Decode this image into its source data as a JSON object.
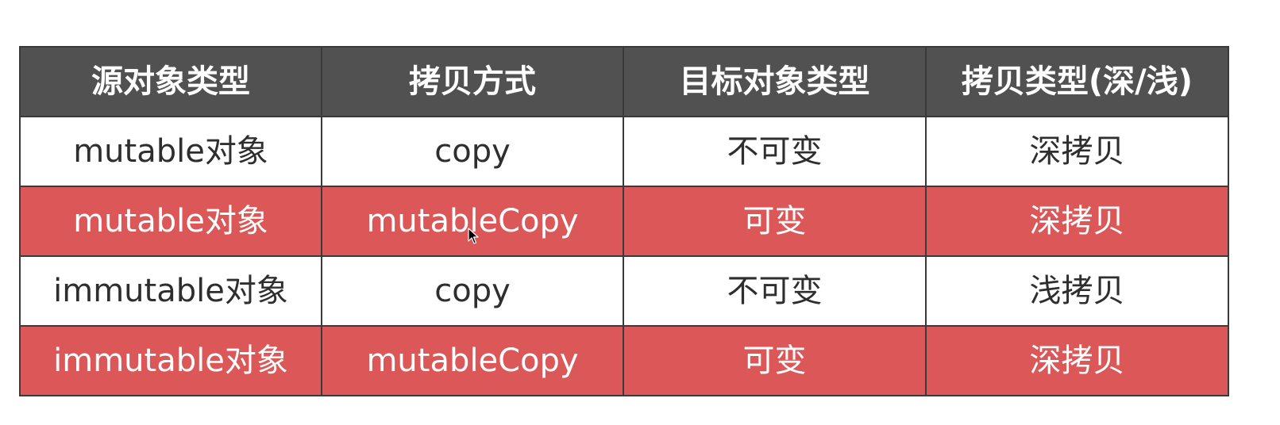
{
  "table": {
    "headers": [
      "源对象类型",
      "拷贝方式",
      "目标对象类型",
      "拷贝类型(深/浅)"
    ],
    "rows": [
      {
        "style": "white",
        "cells": [
          "mutable对象",
          "copy",
          "不可变",
          "深拷贝"
        ]
      },
      {
        "style": "red",
        "cells": [
          "mutable对象",
          "mutableCopy",
          "可变",
          "深拷贝"
        ]
      },
      {
        "style": "white",
        "cells": [
          "immutable对象",
          "copy",
          "不可变",
          "浅拷贝"
        ]
      },
      {
        "style": "red",
        "cells": [
          "immutable对象",
          "mutableCopy",
          "可变",
          "深拷贝"
        ]
      }
    ]
  },
  "colors": {
    "header_bg": "#515151",
    "highlight_row_bg": "#dc5757",
    "plain_row_bg": "#ffffff"
  },
  "icons": {
    "pointer": "mouse-pointer-icon"
  }
}
